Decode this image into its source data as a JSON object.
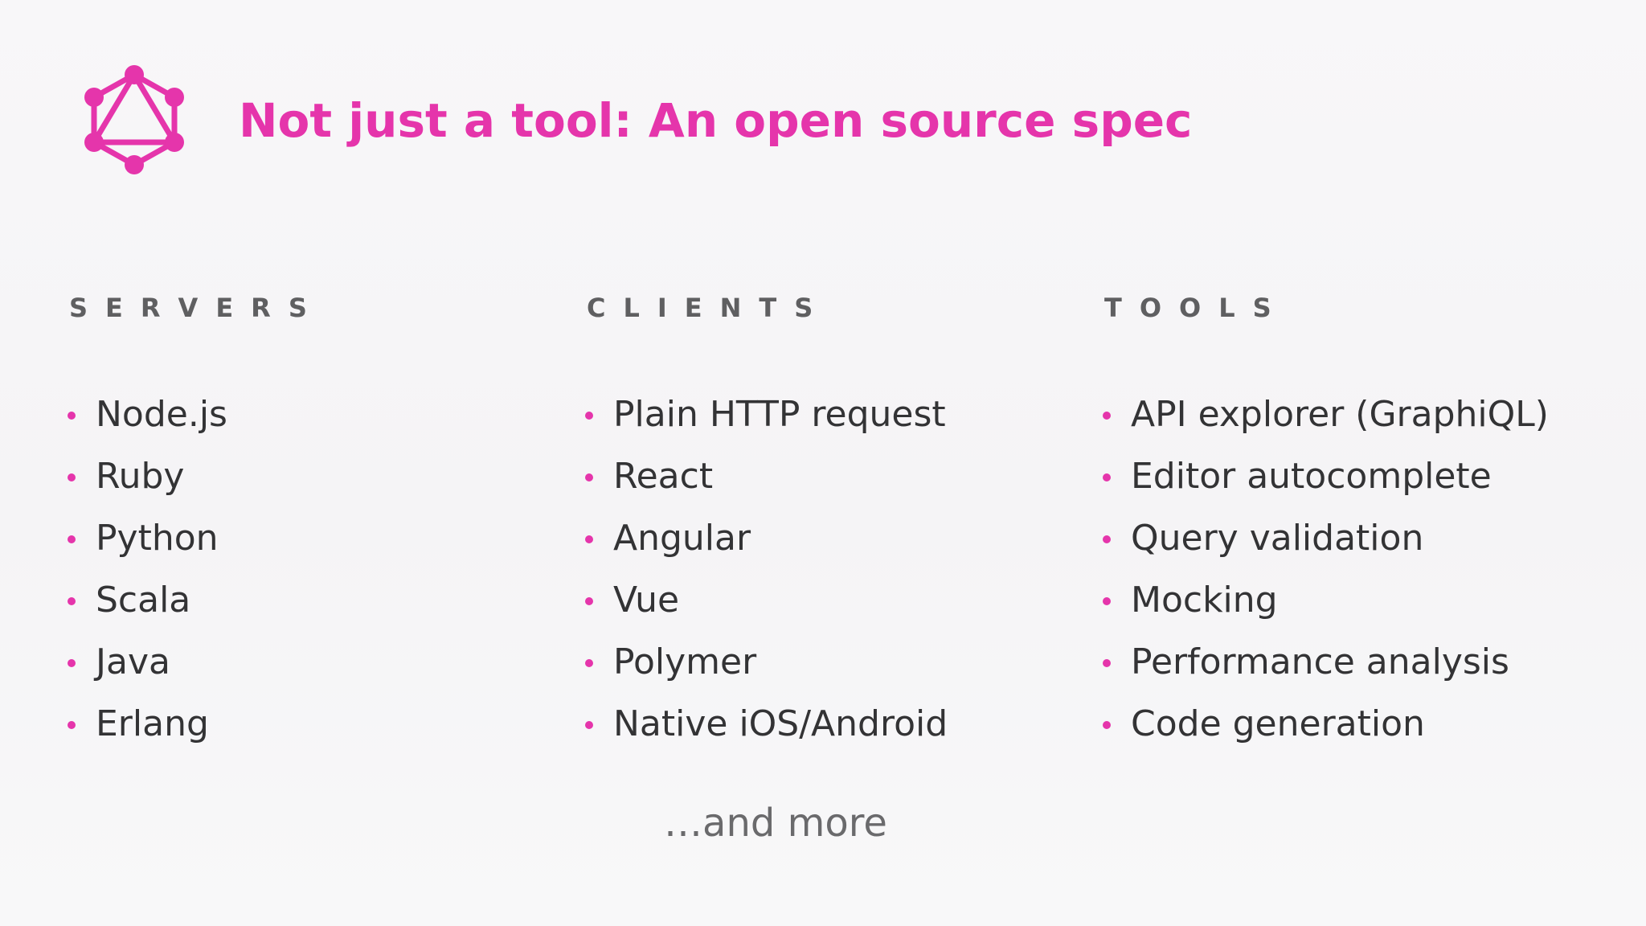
{
  "slide": {
    "title": "Not just a tool: An open source spec",
    "logo_icon": "graphql-logo-icon",
    "accent_color": "#e535ab",
    "columns": [
      {
        "heading": "SERVERS",
        "items": [
          "Node.js",
          "Ruby",
          "Python",
          "Scala",
          "Java",
          "Erlang"
        ]
      },
      {
        "heading": "CLIENTS",
        "items": [
          "Plain HTTP request",
          "React",
          "Angular",
          "Vue",
          "Polymer",
          "Native iOS/Android"
        ]
      },
      {
        "heading": "TOOLS",
        "items": [
          "API explorer (GraphiQL)",
          "Editor autocomplete",
          "Query validation",
          "Mocking",
          "Performance analysis",
          "Code generation"
        ]
      }
    ],
    "footer": "…and more"
  }
}
